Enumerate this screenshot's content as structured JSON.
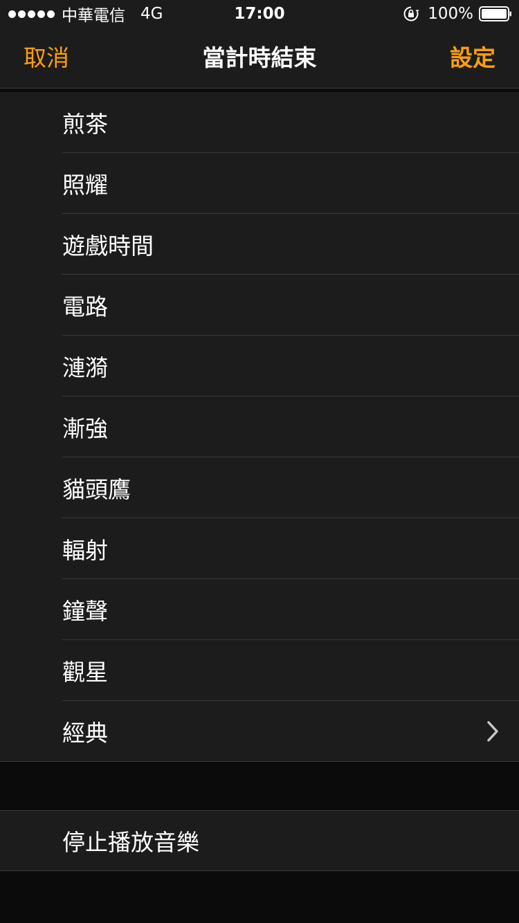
{
  "status_bar": {
    "carrier": "中華電信",
    "network": "4G",
    "time": "17:00",
    "battery": "100%",
    "icons": [
      "signal-dots",
      "rotation-lock-icon",
      "battery-icon"
    ]
  },
  "nav": {
    "cancel": "取消",
    "title": "當計時結束",
    "set": "設定"
  },
  "tones": [
    "煎茶",
    "照耀",
    "遊戲時間",
    "電路",
    "漣漪",
    "漸強",
    "貓頭鷹",
    "輻射",
    "鐘聲",
    "觀星",
    "經典"
  ],
  "stop_music": "停止播放音樂",
  "colors": {
    "accent": "#ff9f0a",
    "background": "#0b0b0b",
    "cell": "#1c1c1c",
    "separator": "#3a3a3a"
  }
}
